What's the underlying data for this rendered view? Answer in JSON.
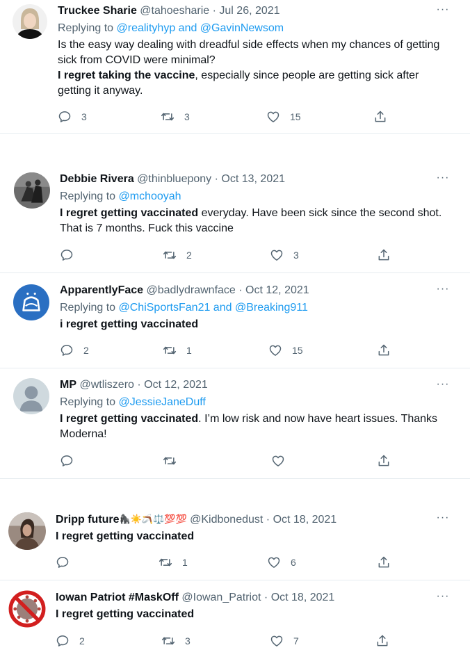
{
  "tweets": [
    {
      "name": "Truckee Sharie",
      "handle": "@tahoesharie",
      "date": "Jul 26, 2021",
      "replying_label": "Replying to ",
      "replying_to": "@realityhyp and @GavinNewsom",
      "body_plain_1": "Is the easy way dealing with dreadful side effects when my chances of getting sick from COVID were minimal?",
      "body_bold": "I regret taking the vaccine",
      "body_plain_2": ", especially since people are getting sick after getting it anyway.",
      "replies": "3",
      "retweets": "3",
      "likes": "15"
    },
    {
      "name": "Debbie Rivera",
      "handle": "@thinbluepony",
      "date": "Oct 13, 2021",
      "replying_label": "Replying to ",
      "replying_to": "@mchooyah",
      "body_bold": "I regret getting vaccinated",
      "body_plain_2": " everyday. Have been sick since the second shot. That is 7 months. Fuck this vaccine",
      "replies": "",
      "retweets": "2",
      "likes": "3"
    },
    {
      "name": "ApparentlyFace",
      "handle": "@badlydrawnface",
      "date": "Oct 12, 2021",
      "replying_label": "Replying to ",
      "replying_to": "@ChiSportsFan21 and @Breaking911",
      "body_bold": "i regret getting vaccinated",
      "replies": "2",
      "retweets": "1",
      "likes": "15"
    },
    {
      "name": "MP",
      "handle": "@wtliszero",
      "date": "Oct 12, 2021",
      "replying_label": "Replying to ",
      "replying_to": "@JessieJaneDuff",
      "body_bold": "I regret getting vaccinated",
      "body_plain_2": ". I’m low risk and now have heart issues. Thanks Moderna!",
      "replies": "",
      "retweets": "",
      "likes": ""
    },
    {
      "name": "Dripp future",
      "name_emojis": "🦍☀️🪃⚖️💯💯",
      "handle": "@Kidbonedust",
      "date": "Oct 18, 2021",
      "body_bold": "I regret getting vaccinated",
      "replies": "",
      "retweets": "1",
      "likes": "6"
    },
    {
      "name": "Iowan Patriot #MaskOff",
      "handle": "@Iowan_Patriot",
      "date": "Oct 18, 2021",
      "body_bold": "I regret getting vaccinated",
      "replies": "2",
      "retweets": "3",
      "likes": "7"
    }
  ],
  "separator_dot": "·",
  "more_glyph": "···",
  "icons": {
    "reply": "reply-icon",
    "retweet": "retweet-icon",
    "like": "like-icon",
    "share": "share-icon",
    "more": "more-icon"
  },
  "colors": {
    "link": "#1d9bf0",
    "secondary_text": "#536471",
    "divider": "#e6ecf0"
  }
}
